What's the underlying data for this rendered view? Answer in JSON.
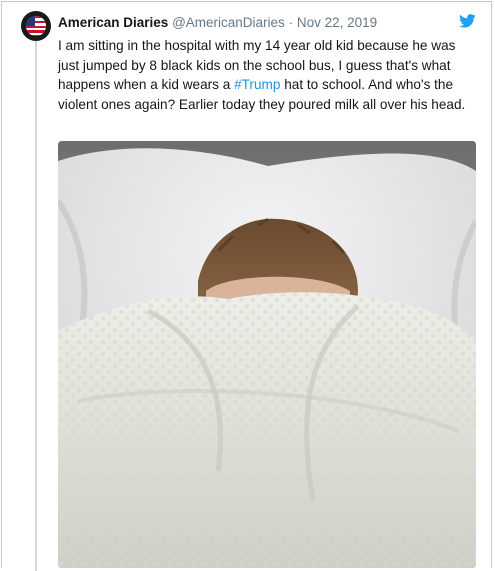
{
  "tweet": {
    "author_name": "American Diaries",
    "handle": "@AmericanDiaries",
    "separator": "·",
    "date": "Nov 22, 2019",
    "text_before": "I am sitting in the hospital with my 14 year old kid because he was just jumped by 8 black kids on the school bus, I guess that's what happens when a kid wears a ",
    "hashtag": "#Trump",
    "text_after": " hat to school. And who's the violent ones again? Earlier today they poured milk all over his head."
  },
  "icons": {
    "platform_icon": "twitter-bird-icon",
    "avatar": "american-flag-avatar"
  },
  "colors": {
    "hashtag": "#1b95e0",
    "twitter_blue": "#1da1f2",
    "muted_text": "#657786",
    "thread_line": "#cfd9de"
  }
}
